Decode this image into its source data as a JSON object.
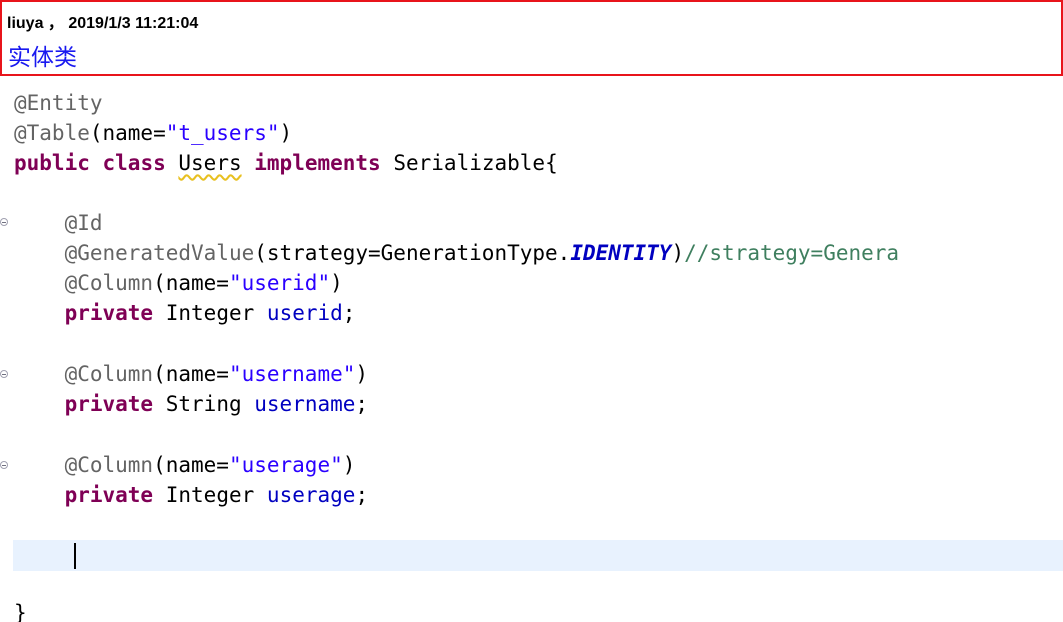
{
  "note": {
    "header": "liuya ， 2019/1/3 11:21:04",
    "title": "实体类"
  },
  "code": {
    "l1_ann": "@Entity",
    "l2_ann": "@Table",
    "l2_open": "(name=",
    "l2_str": "\"t_users\"",
    "l2_close": ")",
    "l3_kw1": "public",
    "l3_kw2": "class",
    "l3_name": "Users",
    "l3_kw3": "implements",
    "l3_iface": "Serializable{",
    "l5_ann": "@Id",
    "l6_ann": "@GeneratedValue",
    "l6_mid": "(strategy=GenerationType.",
    "l6_const": "IDENTITY",
    "l6_close": ")",
    "l6_comment": "//strategy=Genera",
    "l7_ann": "@Column",
    "l7_open": "(name=",
    "l7_str": "\"userid\"",
    "l7_close": ")",
    "l8_kw": "private",
    "l8_type": "Integer",
    "l8_field": "userid",
    "l8_semi": ";",
    "l10_ann": "@Column",
    "l10_open": "(name=",
    "l10_str": "\"username\"",
    "l10_close": ")",
    "l11_kw": "private",
    "l11_type": "String",
    "l11_field": "username",
    "l11_semi": ";",
    "l13_ann": "@Column",
    "l13_open": "(name=",
    "l13_str": "\"userage\"",
    "l13_close": ")",
    "l14_kw": "private",
    "l14_type": "Integer",
    "l14_field": "userage",
    "l14_semi": ";",
    "l17_brace": "}"
  },
  "icons": {
    "fold": "collapse-fold-icon"
  }
}
